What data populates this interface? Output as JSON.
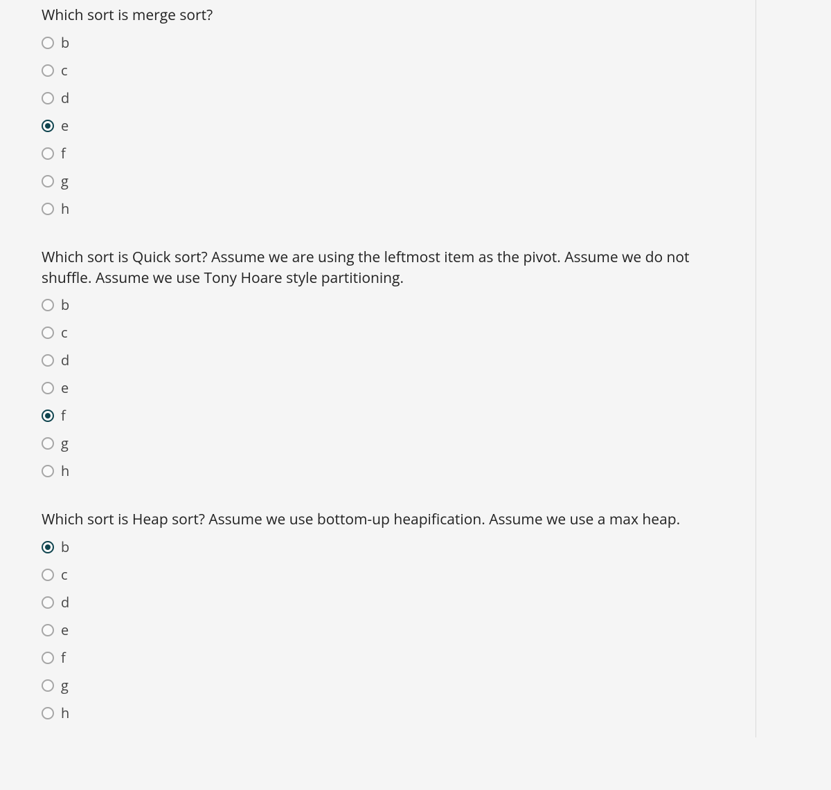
{
  "colors": {
    "accent": "#10454f",
    "radio_border_unselected": "#a6a6a6",
    "background": "#f5f5f5"
  },
  "questions": [
    {
      "id": "q-merge-sort",
      "prompt": "Which sort is merge sort?",
      "selected": "e",
      "options": [
        {
          "value": "b",
          "label": "b"
        },
        {
          "value": "c",
          "label": "c"
        },
        {
          "value": "d",
          "label": "d"
        },
        {
          "value": "e",
          "label": "e"
        },
        {
          "value": "f",
          "label": "f"
        },
        {
          "value": "g",
          "label": "g"
        },
        {
          "value": "h",
          "label": "h"
        }
      ]
    },
    {
      "id": "q-quick-sort",
      "prompt": "Which sort is Quick sort? Assume we are using the leftmost item as the pivot. Assume we do not shuffle. Assume we use Tony Hoare style partitioning.",
      "selected": "f",
      "options": [
        {
          "value": "b",
          "label": "b"
        },
        {
          "value": "c",
          "label": "c"
        },
        {
          "value": "d",
          "label": "d"
        },
        {
          "value": "e",
          "label": "e"
        },
        {
          "value": "f",
          "label": "f"
        },
        {
          "value": "g",
          "label": "g"
        },
        {
          "value": "h",
          "label": "h"
        }
      ]
    },
    {
      "id": "q-heap-sort",
      "prompt": "Which sort is Heap sort? Assume we use bottom-up heapification. Assume we use a max heap.",
      "selected": "b",
      "options": [
        {
          "value": "b",
          "label": "b"
        },
        {
          "value": "c",
          "label": "c"
        },
        {
          "value": "d",
          "label": "d"
        },
        {
          "value": "e",
          "label": "e"
        },
        {
          "value": "f",
          "label": "f"
        },
        {
          "value": "g",
          "label": "g"
        },
        {
          "value": "h",
          "label": "h"
        }
      ]
    }
  ]
}
